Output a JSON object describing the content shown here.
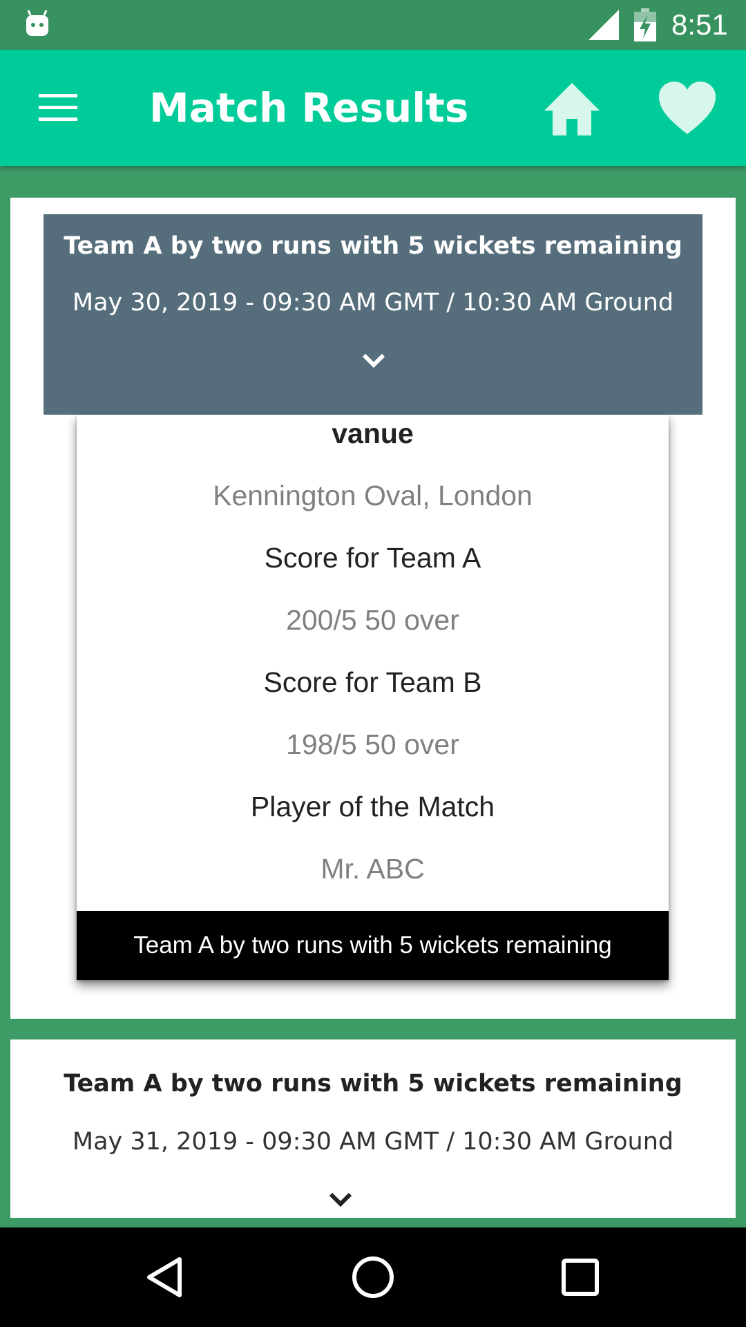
{
  "status_bar": {
    "time": "8:51",
    "left_icon": "android-notification-icon",
    "signal_icon": "cell-signal-icon",
    "battery_icon": "battery-charging-icon"
  },
  "app_bar": {
    "title": "Match Results",
    "menu_icon": "hamburger-menu-icon",
    "home_icon": "home-icon",
    "favorite_icon": "heart-icon",
    "color": "#00cc99"
  },
  "matches": [
    {
      "title": "Team A by two runs with 5 wickets remaining",
      "date": "May 30, 2019 - 09:30 AM GMT / 10:30 AM Ground",
      "expanded": true,
      "details": {
        "venue_heading": "vanue",
        "venue": "Kennington Oval, London",
        "team_a_label": "Score for Team A",
        "team_a_score": "200/5 50 over",
        "team_b_label": "Score for Team B",
        "team_b_score": "198/5 50 over",
        "potm_label": "Player of the Match",
        "potm": "Mr. ABC",
        "result": "Team A by two runs with 5 wickets remaining"
      }
    },
    {
      "title": "Team A by two runs with 5 wickets remaining",
      "date": "May 31, 2019 - 09:30 AM GMT / 10:30 AM Ground",
      "expanded": false
    }
  ],
  "nav_bar": {
    "back_icon": "back-triangle-icon",
    "home_icon": "home-circle-icon",
    "recents_icon": "recents-square-icon"
  },
  "colors": {
    "status_bar": "#38925f",
    "background": "#3d9b66",
    "header_expanded": "#566e7c",
    "result_banner": "#000000"
  }
}
